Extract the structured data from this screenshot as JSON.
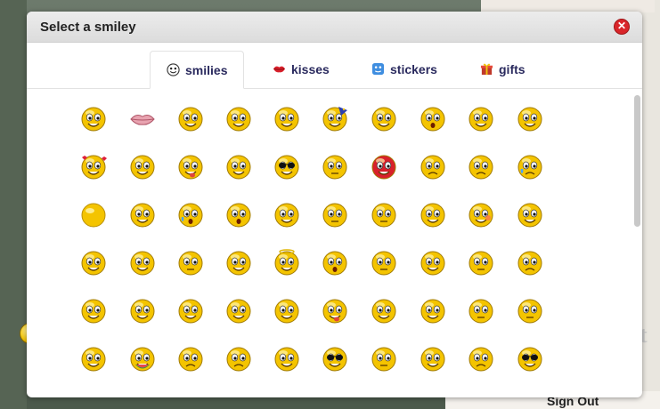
{
  "dialog": {
    "title": "Select a smiley",
    "close": "✕"
  },
  "tabs": [
    {
      "label": "smilies",
      "icon": "smiley-tab-icon",
      "active": true
    },
    {
      "label": "kisses",
      "icon": "lips-tab-icon",
      "active": false
    },
    {
      "label": "stickers",
      "icon": "sticker-tab-icon",
      "active": false
    },
    {
      "label": "gifts",
      "icon": "gift-tab-icon",
      "active": false
    }
  ],
  "background": {
    "signout": "Sign Out",
    "right_glyph": "t"
  },
  "colors": {
    "smiley_face": "#f4c400",
    "accent_red": "#d9252a",
    "tab_text": "#2a2a5e"
  },
  "smileys": [
    [
      "smile-cover-mouth",
      "lips",
      "grin",
      "skeptical",
      "smirk",
      "party",
      "wink",
      "surprised",
      "hands-on-cheeks",
      "laughing"
    ],
    [
      "love-struck",
      "big-eyes",
      "tongue-out",
      "side-eye",
      "cool",
      "unamused",
      "angry",
      "worried",
      "frown",
      "crying"
    ],
    [
      "ball",
      "happy",
      "sweat",
      "shocked",
      "thinking",
      "bored-hands",
      "sideways-glance",
      "nerd",
      "blushing",
      "wide-eyes"
    ],
    [
      "rage-fists",
      "pleased",
      "neutral-eyes",
      "evil",
      "angel",
      "scream",
      "annoyed",
      "dubious",
      "sly",
      "doubtful"
    ],
    [
      "secret",
      "sleepy",
      "rolling-eyes",
      "crafty",
      "pointing",
      "tongue-wink",
      "raised-brow",
      "eyes-right",
      "unsure",
      "meh"
    ],
    [
      "gritted-teeth",
      "watermelon",
      "sad-eyes",
      "grumpy",
      "pout",
      "peeking",
      "suspicious",
      "puzzled",
      "frightened",
      "goggles"
    ]
  ]
}
